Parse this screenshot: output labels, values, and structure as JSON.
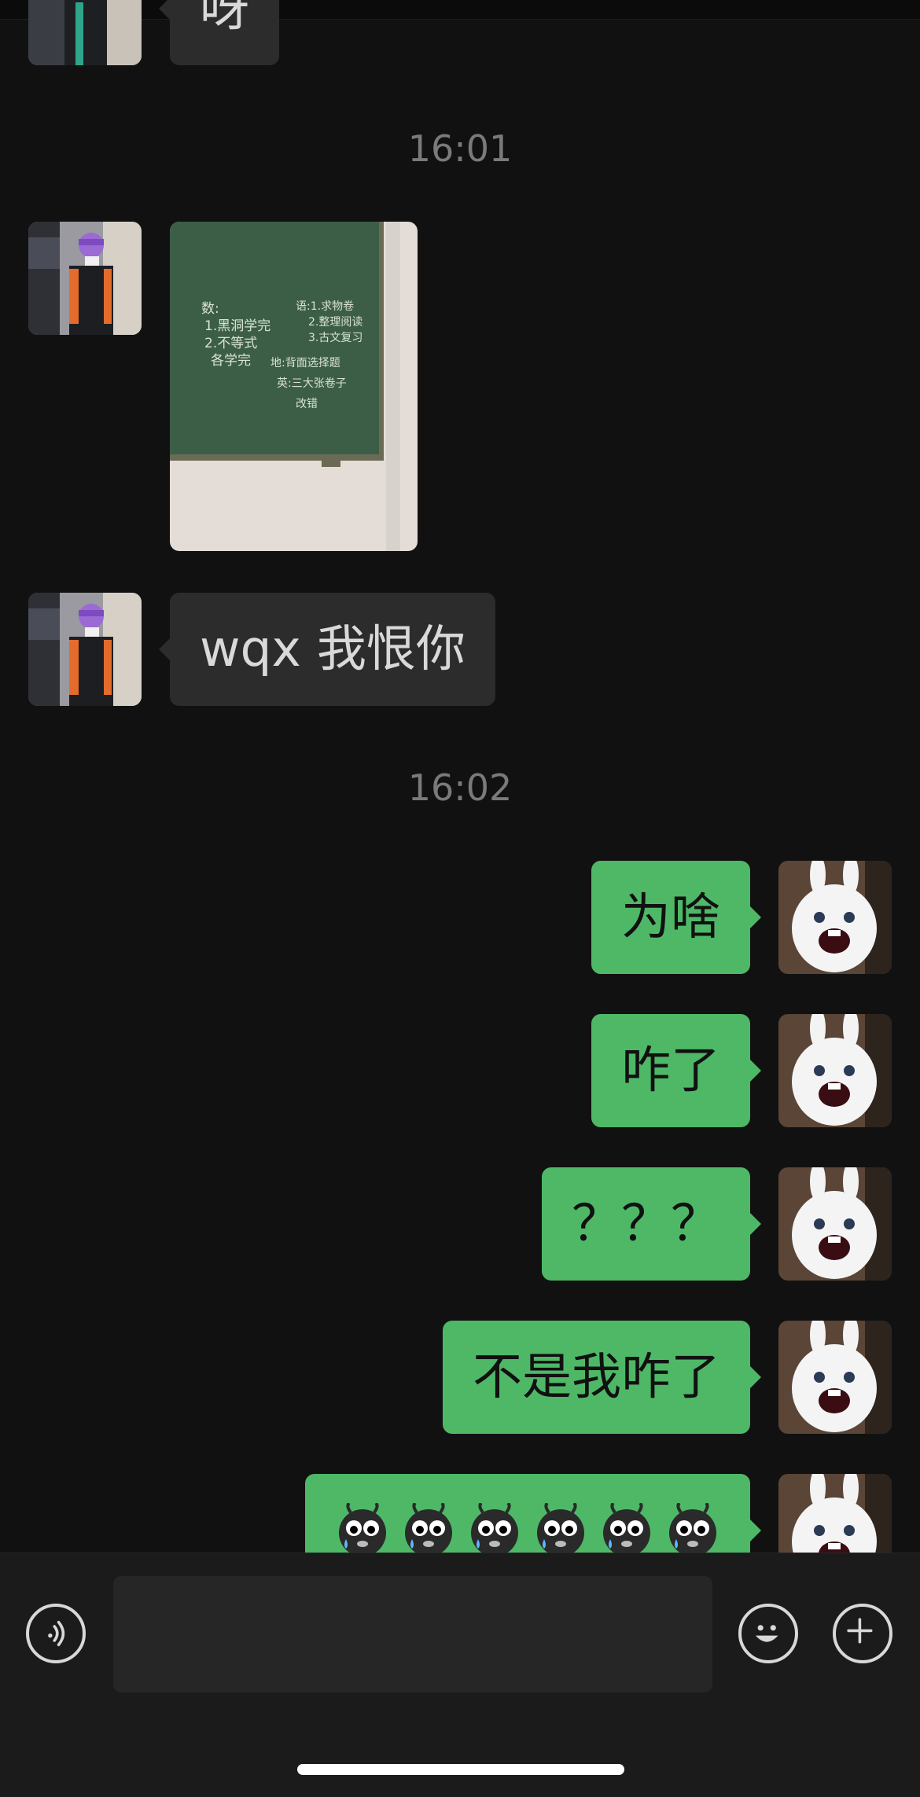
{
  "messages_top": {
    "partial_text": "呀"
  },
  "timestamps": [
    "16:01",
    "16:02"
  ],
  "incoming": {
    "text": "wqx 我恨你"
  },
  "outgoing": [
    {
      "text": "为啥"
    },
    {
      "text": "咋了"
    },
    {
      "text": "？？？"
    },
    {
      "text": "不是我咋了"
    }
  ],
  "photo": {
    "chalk_left": [
      "数:",
      "1.黑洞学完",
      "2.不等式",
      "各学完"
    ],
    "chalk_right": [
      "语:1.求物卷",
      "2.整理阅读",
      "3.古文复习",
      "地:背面选择题",
      "英:三大张卷子",
      "改错"
    ]
  },
  "icons": {
    "voice": "voice-icon",
    "emoji": "smiley-icon",
    "more": "plus-circle-icon",
    "crying_emoji": "crying-face-emoji"
  },
  "colors": {
    "background": "#111111",
    "outgoing_bubble": "#4eb867",
    "incoming_bubble": "#2c2c2c"
  },
  "input": {
    "value": ""
  }
}
